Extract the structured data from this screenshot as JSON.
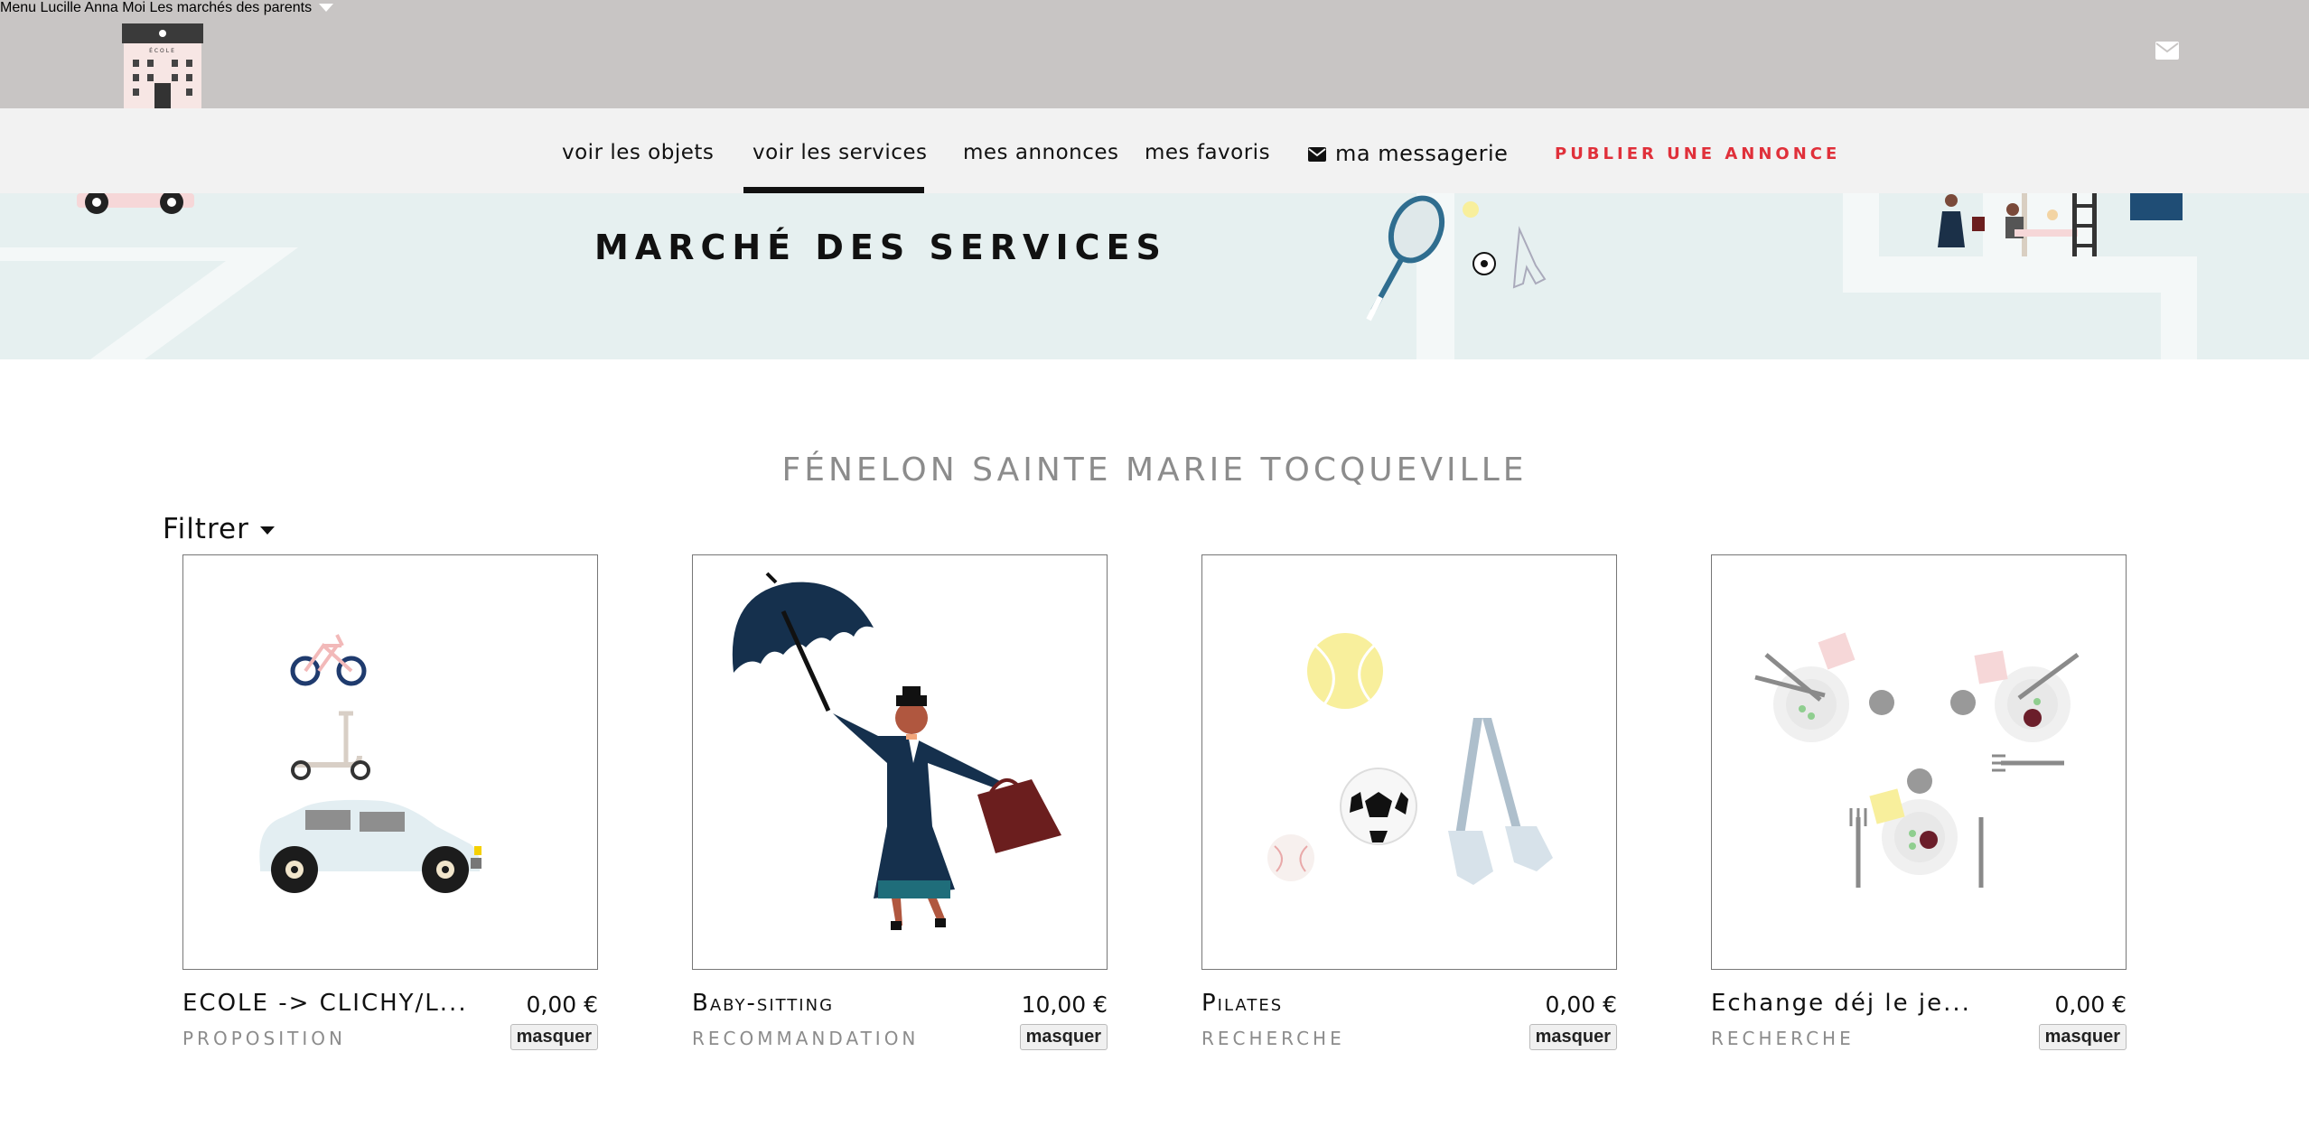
{
  "topbar": {
    "nav": [
      "Menu",
      "Lucille",
      "Anna",
      "Moi",
      "Les marchés des parents"
    ],
    "logo_text": "ÉCOLE"
  },
  "subnav": {
    "items": [
      "voir les objets",
      "voir les services",
      "mes annonces",
      "mes favoris",
      "ma messagerie"
    ],
    "publish": "PUBLIER UNE ANNONCE",
    "active_index": 1
  },
  "banner": {
    "title": "MARCHÉ DES SERVICES"
  },
  "section": {
    "title": "FÉNELON SAINTE MARIE TOCQUEVILLE",
    "filter": "Filtrer"
  },
  "cards": [
    {
      "title": "ECOLE -> CLICHY/L...",
      "price": "0,00 €",
      "type": "PROPOSITION",
      "hide": "masquer",
      "image": "vehicles-illustration"
    },
    {
      "title": "Baby-sitting",
      "price": "10,00 €",
      "type": "RECOMMANDATION",
      "hide": "masquer",
      "image": "nanny-umbrella-illustration"
    },
    {
      "title": "Pilates",
      "price": "0,00 €",
      "type": "RECHERCHE",
      "hide": "masquer",
      "image": "sports-illustration"
    },
    {
      "title": "Echange déj le je...",
      "price": "0,00 €",
      "type": "RECHERCHE",
      "hide": "masquer",
      "image": "lunch-plates-illustration"
    }
  ],
  "colors": {
    "topbar": "#c8c5c4",
    "subnav": "#f2f2f2",
    "banner": "#e6f0f0",
    "publish": "#e0303a",
    "section_title": "#8c8c8c"
  }
}
